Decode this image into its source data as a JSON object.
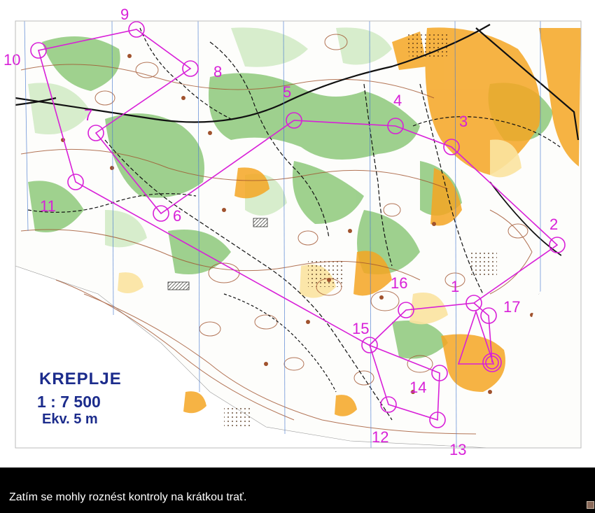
{
  "map": {
    "name": "KREPLJE",
    "scale": "1 : 7 500",
    "contour": "Ekv.  5 m",
    "route_color": "#d81fd8",
    "vegetation_green": "#6fb85a",
    "open_yellow": "#f5a623",
    "contour_brown": "#a0522d",
    "controls": [
      {
        "number": "1"
      },
      {
        "number": "2"
      },
      {
        "number": "3"
      },
      {
        "number": "4"
      },
      {
        "number": "5"
      },
      {
        "number": "6"
      },
      {
        "number": "7"
      },
      {
        "number": "8"
      },
      {
        "number": "9"
      },
      {
        "number": "10"
      },
      {
        "number": "11"
      },
      {
        "number": "12"
      },
      {
        "number": "13"
      },
      {
        "number": "14"
      },
      {
        "number": "15"
      },
      {
        "number": "16"
      },
      {
        "number": "17"
      }
    ]
  },
  "caption": "Zatím se mohly roznést kontroly na krátkou trať."
}
